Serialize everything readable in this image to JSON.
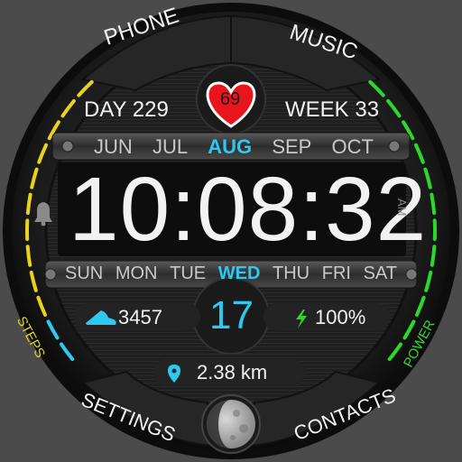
{
  "top_buttons": {
    "phone": "PHONE",
    "music": "MUSIC"
  },
  "bottom_buttons": {
    "settings": "SETTINGS",
    "contacts": "CONTACTS"
  },
  "date": {
    "day_of_year": "DAY 229",
    "week": "WEEK 33",
    "day_of_month": "17"
  },
  "heart_rate": "69",
  "months": [
    "JUN",
    "JUL",
    "AUG",
    "SEP",
    "OCT"
  ],
  "active_month": "AUG",
  "weekdays": [
    "SUN",
    "MON",
    "TUE",
    "WED",
    "THU",
    "FRI",
    "SAT"
  ],
  "active_weekday": "WED",
  "time": {
    "value": "10:08:32",
    "ampm": "AM"
  },
  "steps": {
    "label": "STEPS",
    "value": "3457",
    "progress": 0.55
  },
  "power": {
    "label": "POWER",
    "value": "100%",
    "progress": 1.0
  },
  "distance": "2.38 km",
  "moon_phase": "waning gibbous",
  "colors": {
    "accent": "#2ec9f0",
    "heart": "#e8161c",
    "steps_gauge": "#e8d21a",
    "power_gauge": "#2bd92b",
    "background": "#4b4b4b"
  }
}
